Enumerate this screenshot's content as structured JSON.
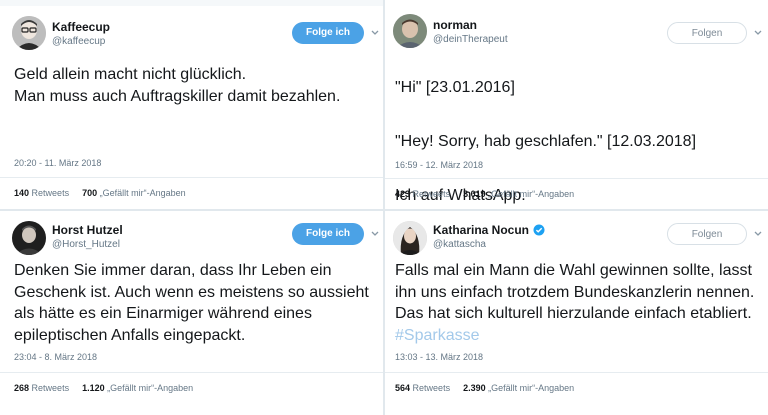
{
  "tweets": [
    {
      "name": "Kaffeecup",
      "handle": "@kaffeecup",
      "button": "Folge ich",
      "text": "Geld allein macht nicht glücklich.\nMan muss auch Auftragskiller damit bezahlen.",
      "time": "20:20 - 11. März 2018",
      "retweets_count": "140",
      "retweets_label": "Retweets",
      "likes_count": "700",
      "likes_label": "„Gefällt mir“-Angaben",
      "avatar_icon": "person-glasses-avatar"
    },
    {
      "name": "norman",
      "handle": "@deinTherapeut",
      "button": "Folgen",
      "text_lines": [
        "\"Hi\" [23.01.2016]",
        "\"Hey! Sorry, hab geschlafen.\" [12.03.2018]",
        "Ich auf WhatsApp."
      ],
      "time": "16:59 - 12. März 2018",
      "retweets_count": "423",
      "retweets_label": "Retweets",
      "likes_count": "3.019",
      "likes_label": "„Gefällt mir“-Angaben",
      "avatar_icon": "person-avatar"
    },
    {
      "name": "Horst Hutzel",
      "handle": "@Horst_Hutzel",
      "button": "Folge ich",
      "text": "Denken Sie immer daran, dass Ihr Leben ein Geschenk ist. Auch wenn es meistens so aussieht als hätte es ein Einarmiger während eines epileptischen Anfalls eingepackt.",
      "time": "23:04 - 8. März 2018",
      "retweets_count": "268",
      "retweets_label": "Retweets",
      "likes_count": "1.120",
      "likes_label": "„Gefällt mir“-Angaben",
      "avatar_icon": "person-dark-avatar"
    },
    {
      "name": "Katharina Nocun",
      "handle": "@kattascha",
      "button": "Folgen",
      "text": "Falls mal ein Mann die Wahl gewinnen sollte, lasst ihn uns einfach trotzdem Bundeskanzlerin nennen. Das hat sich kulturell hierzulande einfach etabliert.",
      "hashtag": "#Sparkasse",
      "time": "13:03 - 13. März 2018",
      "retweets_count": "564",
      "retweets_label": "Retweets",
      "likes_count": "2.390",
      "likes_label": "„Gefällt mir“-Angaben",
      "avatar_icon": "person-woman-avatar",
      "verified_icon": "verified-badge-icon"
    }
  ],
  "colors": {
    "follow_blue": "#4ba2e6",
    "hashtag": "#a3c9ea",
    "meta_gray": "#657786",
    "divider": "#e1e8ed"
  }
}
